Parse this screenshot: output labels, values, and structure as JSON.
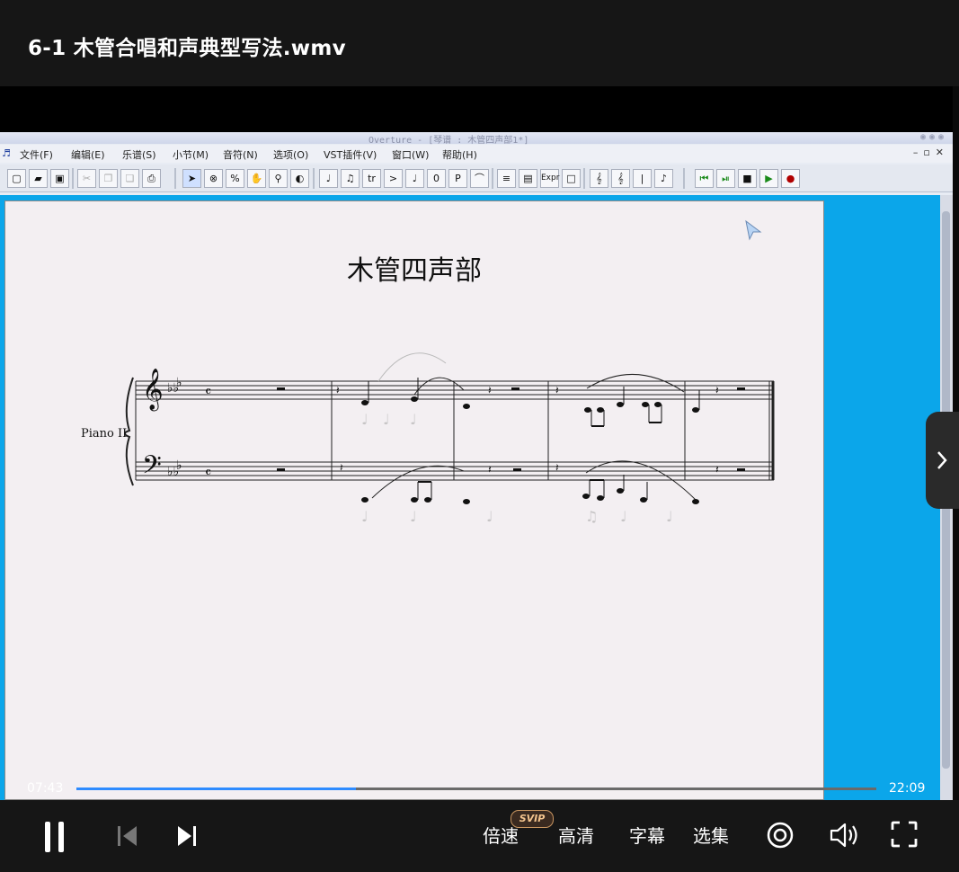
{
  "video": {
    "title": "6-1 木管合唱和声典型写法.wmv",
    "current_time": "07:43",
    "total_time": "22:09",
    "progress": 0.349
  },
  "app": {
    "title": "Overture - [琴谱 : 木管四声部1*]",
    "menus": [
      "文件(F)",
      "编辑(E)",
      "乐谱(S)",
      "小节(M)",
      "音符(N)",
      "选项(O)",
      "VST插件(V)",
      "窗口(W)",
      "帮助(H)"
    ],
    "toolbar_labels": {
      "trill": "tr",
      "accent": ">",
      "zero": "0",
      "piano": "P",
      "expr": "Expr"
    }
  },
  "score": {
    "title": "木管四声部",
    "instrument": "Piano II"
  },
  "controls": {
    "speed": "倍速",
    "svip": "SVIP",
    "quality": "高清",
    "subtitle": "字幕",
    "episodes": "选集"
  },
  "colors": {
    "progress": "#2e8bff",
    "workspace": "#0ba6ea",
    "background": "#161616"
  }
}
